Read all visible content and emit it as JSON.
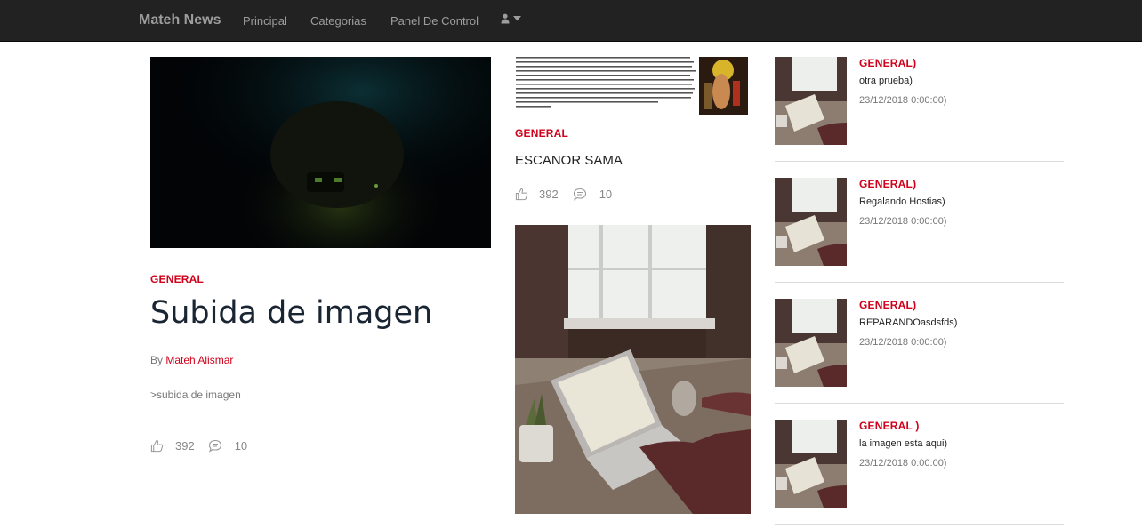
{
  "nav": {
    "brand": "Mateh News",
    "links": [
      "Principal",
      "Categorias",
      "Panel De Control"
    ],
    "user_icon": "user-icon",
    "caret_icon": "caret-down-icon"
  },
  "featured": {
    "category": "GENERAL",
    "title": "Subida de imagen",
    "by_label": "By",
    "author": "Mateh Alismar",
    "description": ">subida de imagen",
    "likes": "392",
    "comments": "10"
  },
  "middle": {
    "category": "GENERAL",
    "title": "ESCANOR SAMA",
    "likes": "392",
    "comments": "10"
  },
  "sidebar": {
    "items": [
      {
        "category": "GENERAL)",
        "title": "otra prueba)",
        "date": "23/12/2018 0:00:00)"
      },
      {
        "category": "GENERAL)",
        "title": "Regalando Hostias)",
        "date": "23/12/2018 0:00:00)"
      },
      {
        "category": "GENERAL)",
        "title": "REPARANDOasdsfds)",
        "date": "23/12/2018 0:00:00)"
      },
      {
        "category": "GENERAL )",
        "title": "la imagen esta aqui)",
        "date": "23/12/2018 0:00:00)"
      }
    ]
  },
  "colors": {
    "accent": "#d0021b",
    "navbar": "#222222",
    "title": "#1a2533"
  },
  "icons": {
    "like": "thumbs-up-icon",
    "comment": "comment-icon"
  }
}
